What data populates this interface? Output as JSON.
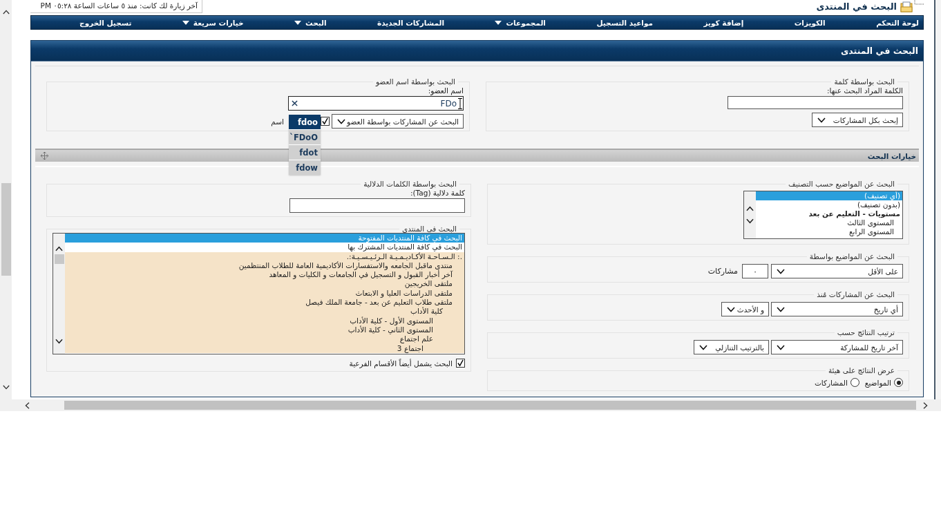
{
  "header": {
    "title": "البحث في المنتدى",
    "last_visit": "آخر زيارة لك كانت: منذ ٥ ساعات الساعة ٠٥:٢٨ PM"
  },
  "navbar": [
    {
      "label": "لوحة التحكم",
      "dropdown": false
    },
    {
      "label": "الكويزات",
      "dropdown": false
    },
    {
      "label": "إضافة كويز",
      "dropdown": false
    },
    {
      "label": "مواعيد التسجيل",
      "dropdown": false
    },
    {
      "label": "المجموعات",
      "dropdown": true
    },
    {
      "label": "المشاركات الجديدة",
      "dropdown": false
    },
    {
      "label": "البحث",
      "dropdown": true
    },
    {
      "label": "خيارات سريعة",
      "dropdown": true
    },
    {
      "label": "تسجيل الخروج",
      "dropdown": false
    }
  ],
  "panel": {
    "title": "البحث في المنتدى"
  },
  "keyword_search": {
    "legend": "البحث بواسطة كلمة",
    "label": "الكلمة المراد البحث عنها:",
    "select": "إبحث بكل المشاركات"
  },
  "member_search": {
    "legend": "البحث بواسطة اسم العضو",
    "label": "اسم العضو:",
    "value": "FDo",
    "select": "البحث عن المشاركات بواسطة العضو",
    "exact": {
      "label": "اسم",
      "checked": true
    },
    "suggestions": [
      {
        "label": "fdoo",
        "selected": true
      },
      {
        "label": "`FDoO",
        "selected": false
      },
      {
        "label": "fdot",
        "selected": false
      },
      {
        "label": "fdow",
        "selected": false
      }
    ]
  },
  "options_bar": {
    "title": "خيارات البحث"
  },
  "tag_search": {
    "legend": "البحث بواسطة الكلمات الدلالية",
    "label": "كلمة دلالية (Tag):"
  },
  "forum_list": {
    "legend": "البحث في المنتدى",
    "options": [
      {
        "label": "البحث في كافة المنتديات المفتوحة",
        "selected": true
      },
      {
        "label": "البحث في كافة المنتديات المشترك بها",
        "selected": false
      }
    ],
    "forums": [
      {
        "label": ".: الـسـاحـة الأكـاديـمـيـة الـرئـيـسـيـة:.",
        "selected": false,
        "children": [
          {
            "label": "منتدى ماقبل الجامعه والاستفسارات الأكاديمية العامة للطلاب المنتظمين",
            "selected": false
          },
          {
            "label": "آخر أخبار القبول و التسجيل في الجامعات و الكليات و المعاهد",
            "selected": false
          },
          {
            "label": "ملتقى الخريجين",
            "selected": false
          },
          {
            "label": "ملتقى الدراسات العليا و الابتعاث",
            "selected": false
          },
          {
            "label": "ملتقى طلاب التعليم عن بعد - جامعة الملك فيصل",
            "selected": false,
            "children": [
              {
                "label": "كلية الأداب",
                "selected": false,
                "children": [
                  {
                    "label": "المستوى الأول - كلية الأداب",
                    "selected": false
                  },
                  {
                    "label": "المستوى الثاني - كلية الأداب",
                    "selected": false
                  },
                  {
                    "label": "علم اجتماع",
                    "selected": false,
                    "children": [
                      {
                        "label": "اجتماع 3",
                        "selected": false
                      }
                    ]
                  }
                ]
              }
            ]
          }
        ]
      }
    ],
    "subforums": {
      "label": "البحث يشمل أيضاً الأقسام الفرعية",
      "checked": true
    }
  },
  "prefix_search": {
    "legend": "البحث عن المواضيع حسب التصنيف",
    "items": [
      {
        "label": "(أي تصنيف)",
        "selected": true
      },
      {
        "label": "(بدون تصنيف)",
        "selected": false
      },
      {
        "label": "مستويات - التعليم عن بعد",
        "children": [
          {
            "label": "المستوى الثالث",
            "selected": false
          },
          {
            "label": "المستوى الرابع",
            "selected": false
          }
        ]
      }
    ]
  },
  "replies_search": {
    "legend": "البحث عن المواضيع بواسطة",
    "select": "على الأقل",
    "value": "٠",
    "unit": "مشاركات"
  },
  "date_search": {
    "legend": "البحث عن المشاركات مُنذ",
    "select": "أي تاريخ",
    "direction": "و الأحدث"
  },
  "sort": {
    "legend": "ترتيب النتائج حسب",
    "select": "آخر تاريخ للمشاركة",
    "order": "بالترتيب التنازلي"
  },
  "display": {
    "legend": "عرض النتائج على هيئة",
    "options": [
      {
        "label": "المواضيع",
        "selected": true
      },
      {
        "label": "المشاركات",
        "selected": false
      }
    ]
  }
}
